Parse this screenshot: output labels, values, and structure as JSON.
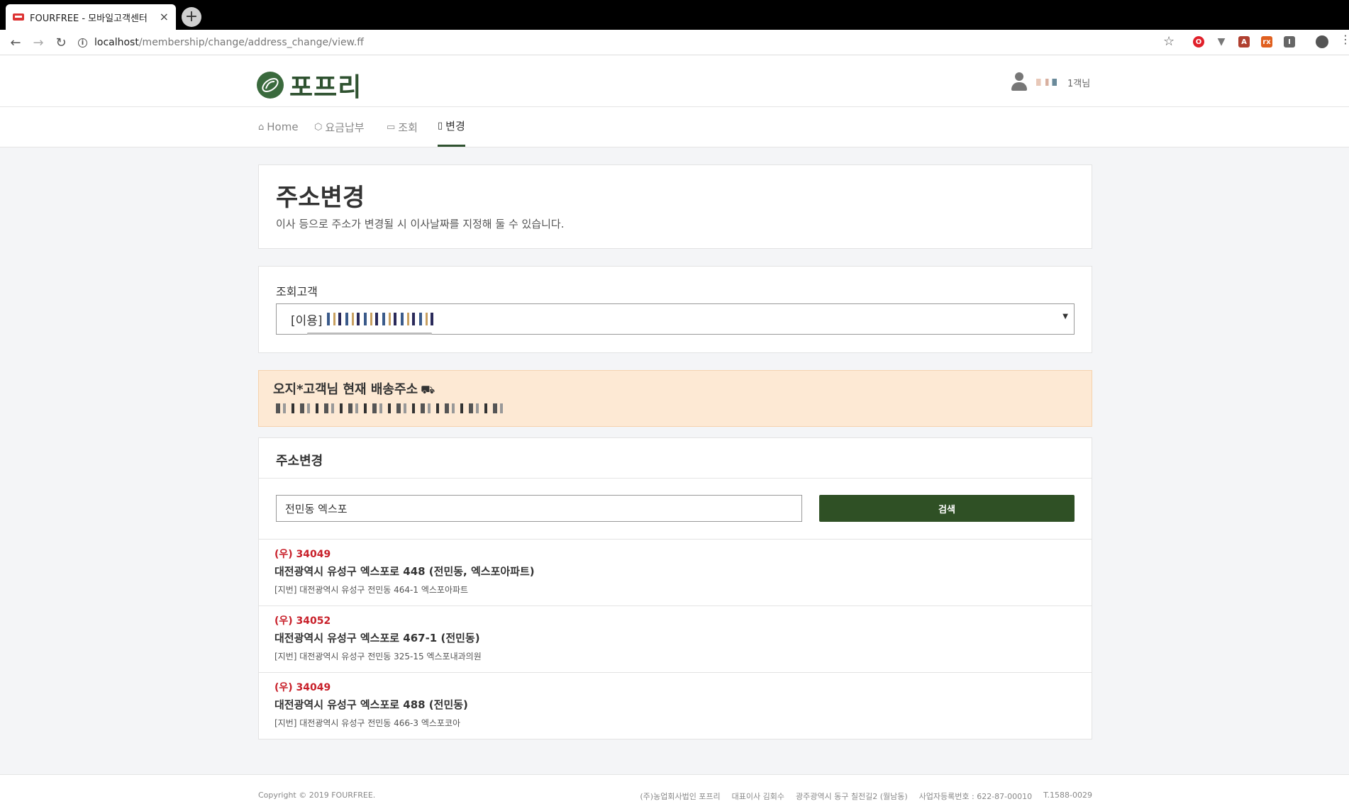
{
  "browser": {
    "tab_title": "FOURFREE - 모바일고객센터",
    "tab_close": "×",
    "new_tab": "+",
    "url_host": "localhost",
    "url_path": "/membership/change/address_change/view.ff"
  },
  "header": {
    "logo_text": "포프리",
    "user_suffix": "1객님"
  },
  "nav": {
    "items": [
      {
        "label": "Home",
        "icon": "home-icon"
      },
      {
        "label": "요금납부",
        "icon": "box-icon"
      },
      {
        "label": "조회",
        "icon": "calendar-icon"
      },
      {
        "label": "변경",
        "icon": "document-icon"
      }
    ],
    "active": "변경"
  },
  "intro": {
    "title": "주소변경",
    "description": "이사 등으로 주소가 변경될 시 이사날짜를 지정해 둘 수 있습니다."
  },
  "customer_select": {
    "label": "조회고객",
    "selected_prefix": "[이용]"
  },
  "current_address": {
    "title": "오지*고객님 현재 배송주소"
  },
  "address_change": {
    "title": "주소변경",
    "search_value": "전민동 엑스포",
    "search_button": "검색",
    "results": [
      {
        "zip": "(우) 34049",
        "road": "대전광역시 유성구 엑스포로 448 (전민동, 엑스포아파트)",
        "jibun": "[지번] 대전광역시 유성구 전민동 464-1 엑스포아파트"
      },
      {
        "zip": "(우) 34052",
        "road": "대전광역시 유성구 엑스포로 467-1 (전민동)",
        "jibun": "[지번] 대전광역시 유성구 전민동 325-15 엑스포내과의원"
      },
      {
        "zip": "(우) 34049",
        "road": "대전광역시 유성구 엑스포로 488 (전민동)",
        "jibun": "[지번] 대전광역시 유성구 전민동 466-3 엑스포코아"
      }
    ]
  },
  "footer": {
    "copyright": "Copyright © 2019 FOURFREE.",
    "company": "(주)농업회사법인 포프리",
    "ceo": "대표이사 김회수",
    "address": "광주광역시 동구 칠전길2 (월남동)",
    "biz_no": "사업자등록번호 : 622-87-00010",
    "tel": "T.1588-0029"
  },
  "colors": {
    "brand_green": "#2f5230",
    "button_green": "#2f5025",
    "zip_red": "#c8202a",
    "alert_bg": "#fde9d4"
  }
}
